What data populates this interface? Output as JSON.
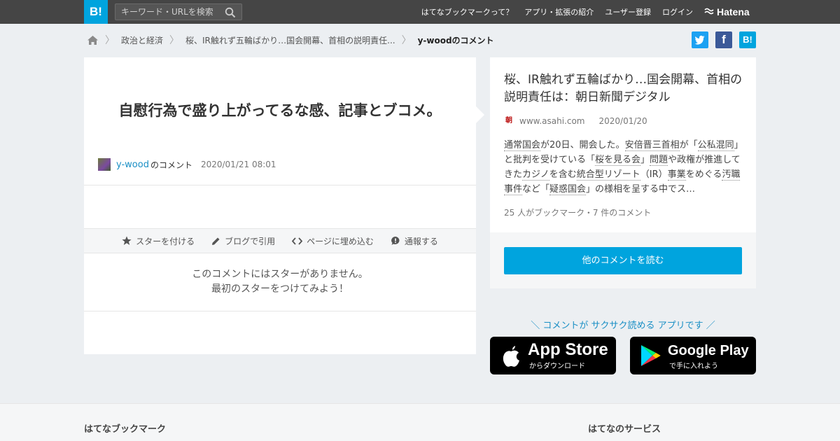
{
  "header": {
    "logo": "B!",
    "search_placeholder": "キーワード・URLを検索",
    "nav": [
      "はてなブックマークって？",
      "アプリ・拡張の紹介",
      "ユーザー登録",
      "ログイン"
    ],
    "hatena": "Hatena"
  },
  "breadcrumb": {
    "items": [
      "政治と経済",
      "桜、IR触れず五輪ばかり…国会開幕、首相の説明責任...",
      "y-woodのコメント"
    ]
  },
  "share": {
    "twitter": "t",
    "facebook": "f",
    "hatena": "B!"
  },
  "comment": {
    "text": "自慰行為で盛り上がってるな感、記事とブコメ。",
    "user": "y-wood",
    "suffix": "のコメント",
    "date": "2020/01/21 08:01",
    "actions": [
      "スターを付ける",
      "ブログで引用",
      "ページに埋め込む",
      "通報する"
    ],
    "no_star_line1": "このコメントにはスターがありません。",
    "no_star_line2": "最初のスターをつけてみよう！"
  },
  "article": {
    "title": "桜、IR触れず五輪ばかり…国会開幕、首相の説明責任は：朝日新聞デジタル",
    "favicon": "朝",
    "domain": "www.asahi.com",
    "date": "2020/01/20",
    "desc_parts": [
      {
        "t": "通常国会",
        "u": true
      },
      {
        "t": "が20日、開会した。",
        "u": false
      },
      {
        "t": "安倍晋三首相",
        "u": true
      },
      {
        "t": "が「",
        "u": false
      },
      {
        "t": "公私混同",
        "u": true
      },
      {
        "t": "」と批判を受けている「",
        "u": false
      },
      {
        "t": "桜を見る会",
        "u": true
      },
      {
        "t": "」",
        "u": false
      },
      {
        "t": "問題",
        "u": true
      },
      {
        "t": "や政権が推進してきた",
        "u": false
      },
      {
        "t": "カジノ",
        "u": true
      },
      {
        "t": "を含む",
        "u": false
      },
      {
        "t": "統合型リゾート",
        "u": true
      },
      {
        "t": "（IR）",
        "u": false
      },
      {
        "t": "事業",
        "u": true
      },
      {
        "t": "をめぐる",
        "u": false
      },
      {
        "t": "汚職事件",
        "u": true
      },
      {
        "t": "など「",
        "u": false
      },
      {
        "t": "疑惑国会",
        "u": true
      },
      {
        "t": "」の様相を呈する中でス…",
        "u": false
      }
    ],
    "count": "25 人がブックマーク・7 件のコメント",
    "read_button": "他のコメントを読む"
  },
  "promo": {
    "text": "＼ コメントが サクサク読める アプリです ／",
    "appstore_big": "App Store",
    "appstore_small": "からダウンロード",
    "googleplay_big": "Google Play",
    "googleplay_small": "で手に入れよう"
  },
  "footer": {
    "left": "はてなブックマーク",
    "right": "はてなのサービス"
  },
  "colors": {
    "accent": "#00a4de",
    "link": "#1a8fc5",
    "topbar": "#454545",
    "twitter": "#1da1f2",
    "facebook": "#3b5998"
  }
}
